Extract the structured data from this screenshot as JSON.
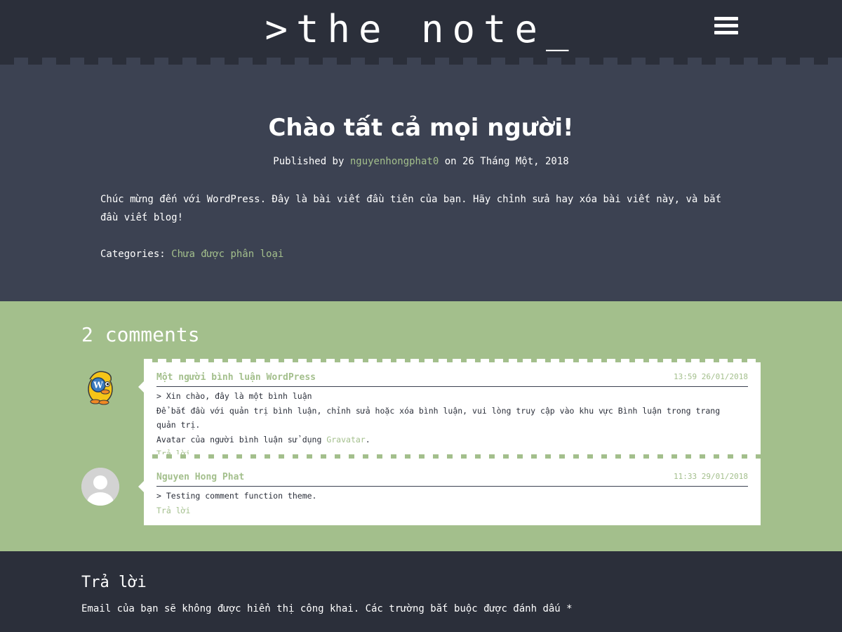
{
  "header": {
    "logo": ">the note_",
    "menu_icon": "hamburger-menu-icon"
  },
  "post": {
    "title": "Chào tất cả mọi người!",
    "meta_prefix": "Published by ",
    "author": "nguyenhongphat0",
    "meta_on": " on ",
    "date": "26 Tháng Một, 2018",
    "content": "Chúc mừng đến với WordPress. Đây là bài viết đầu tiên của bạn. Hãy chỉnh sửa hay xóa bài viết này, và bắt đầu viết blog!",
    "categories_label": "Categories: ",
    "category": "Chưa được phân loại"
  },
  "comments": {
    "title": "2 comments",
    "items": [
      {
        "author": "Một người bình luận WordPress",
        "date": "13:59 26/01/2018",
        "line1": "> Xin chào, đây là một bình luận",
        "line2": "Để bắt đầu với quản trị bình luận, chỉnh sửa hoặc xóa bình luận, vui lòng truy cập vào khu vực Bình luận trong trang quản trị.",
        "line3_prefix": "Avatar của người bình luận sử dụng ",
        "line3_link": "Gravatar",
        "line3_suffix": ".",
        "reply": "Trả lời",
        "avatar_icon": "wordpress-mascot-avatar-icon"
      },
      {
        "author": "Nguyen Hong Phat",
        "date": "11:33 29/01/2018",
        "line1": "> Testing comment function theme.",
        "reply": "Trả lời",
        "avatar_icon": "default-user-avatar-icon"
      }
    ]
  },
  "reply": {
    "title": "Trả lời",
    "notes": "Email của bạn sẽ không được hiển thị công khai. Các trường bắt buộc được đánh dấu *"
  },
  "colors": {
    "header_bg": "#2b2f3a",
    "post_bg": "#3c4252",
    "accent_green": "#a3bf8c",
    "white": "#ffffff"
  }
}
